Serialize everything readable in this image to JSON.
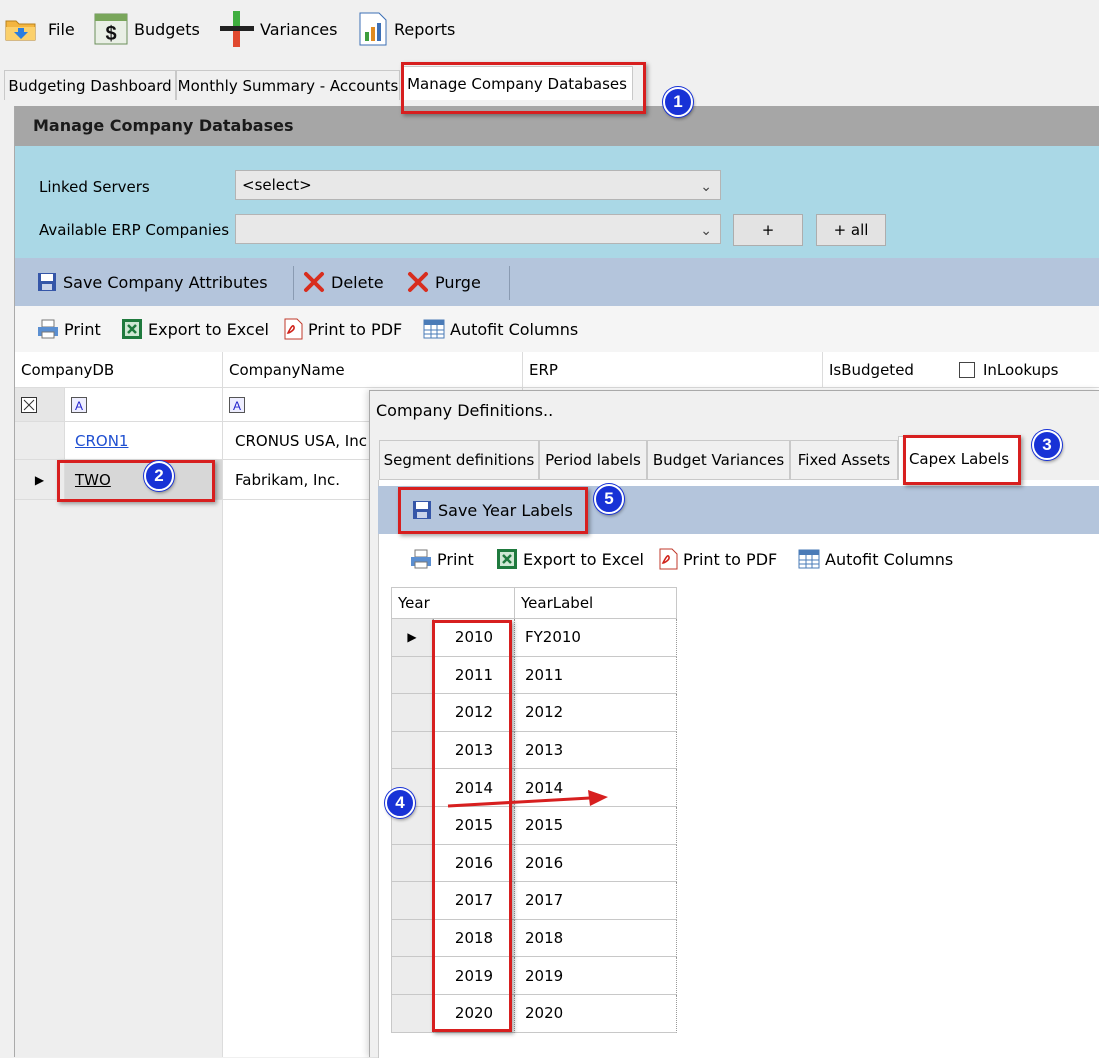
{
  "menu": [
    {
      "label": "File",
      "icon": "folder-icon"
    },
    {
      "label": "Budgets",
      "icon": "dollar-icon"
    },
    {
      "label": "Variances",
      "icon": "variance-icon"
    },
    {
      "label": "Reports",
      "icon": "report-icon"
    }
  ],
  "tabs": [
    "Budgeting Dashboard",
    "Monthly Summary - Accounts",
    "Manage Company Databases"
  ],
  "panel": {
    "title": "Manage Company Databases",
    "linked_servers_label": "Linked Servers",
    "linked_servers_value": "<select>",
    "erp_companies_label": "Available ERP Companies",
    "erp_companies_value": "",
    "add_label": "+",
    "add_all_label": "+ all"
  },
  "toolbar": {
    "save_label": "Save Company Attributes",
    "delete_label": "Delete",
    "purge_label": "Purge"
  },
  "export_toolbar": {
    "print_label": "Print",
    "excel_label": "Export to Excel",
    "pdf_label": "Print to PDF",
    "autofit_label": "Autofit Columns"
  },
  "grid": {
    "columns": [
      "CompanyDB",
      "CompanyName",
      "ERP",
      "IsBudgeted",
      "InLookups"
    ],
    "rows": [
      {
        "db": "CRON1",
        "name": "CRONUS USA, Inc"
      },
      {
        "db": "TWO",
        "name": "Fabrikam, Inc."
      }
    ]
  },
  "dialog": {
    "title": "Company Definitions..",
    "tabs": [
      "Segment definitions",
      "Period labels",
      "Budget Variances",
      "Fixed Assets",
      "Capex Labels"
    ],
    "save_label": "Save Year Labels",
    "print_label": "Print",
    "excel_label": "Export to Excel",
    "pdf_label": "Print to PDF",
    "autofit_label": "Autofit Columns",
    "columns": [
      "Year",
      "YearLabel"
    ],
    "rows": [
      {
        "year": "2010",
        "label": "FY2010"
      },
      {
        "year": "2011",
        "label": "2011"
      },
      {
        "year": "2012",
        "label": "2012"
      },
      {
        "year": "2013",
        "label": "2013"
      },
      {
        "year": "2014",
        "label": "2014"
      },
      {
        "year": "2015",
        "label": "2015"
      },
      {
        "year": "2016",
        "label": "2016"
      },
      {
        "year": "2017",
        "label": "2017"
      },
      {
        "year": "2018",
        "label": "2018"
      },
      {
        "year": "2019",
        "label": "2019"
      },
      {
        "year": "2020",
        "label": "2020"
      }
    ]
  },
  "annotations": [
    "1",
    "2",
    "3",
    "4",
    "5"
  ],
  "colors": {
    "annotation_red": "#d71f1f",
    "badge_blue": "#1832d6",
    "filter_bg": "#aad8e6",
    "toolbar_bg": "#b4c5dc"
  }
}
